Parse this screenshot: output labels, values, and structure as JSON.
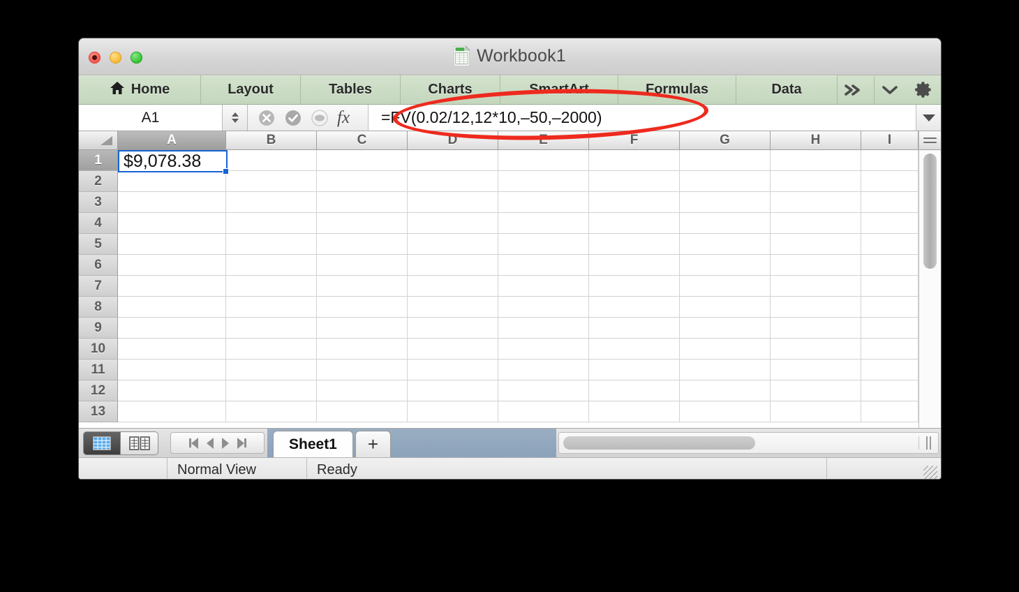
{
  "window": {
    "title": "Workbook1",
    "doc_icon": "excel-workbook-icon",
    "traffic_lights": [
      "close-button",
      "minimize-button",
      "zoom-button"
    ]
  },
  "ribbon": {
    "tabs": [
      {
        "label": "Home",
        "icon": "home-icon",
        "active": false
      },
      {
        "label": "Layout",
        "active": false
      },
      {
        "label": "Tables",
        "active": false
      },
      {
        "label": "Charts",
        "active": false
      },
      {
        "label": "SmartArt",
        "active": false
      },
      {
        "label": "Formulas",
        "active": false
      },
      {
        "label": "Data",
        "active": false
      }
    ],
    "controls": [
      {
        "name": "expand-chevrons-icon",
        "glyph": "»"
      },
      {
        "name": "collapse-ribbon-chevron-icon",
        "glyph": "⌄"
      },
      {
        "name": "settings-gear-icon",
        "glyph": "⚙"
      },
      {
        "name": "settings-dropdown-arrow-icon",
        "glyph": "▼"
      }
    ]
  },
  "formula_bar": {
    "name_box_value": "A1",
    "cancel_icon": "cancel-x-icon",
    "confirm_icon": "confirm-check-icon",
    "calculator_icon": "calculator-icon",
    "fx_label": "fx",
    "formula": "=FV(0.02/12,12*10,‒50,‒2000)",
    "expand_icon": "expand-formula-bar-icon"
  },
  "grid": {
    "columns": [
      "A",
      "B",
      "C",
      "D",
      "E",
      "F",
      "G",
      "H",
      "I"
    ],
    "rows": [
      "1",
      "2",
      "3",
      "4",
      "5",
      "6",
      "7",
      "8",
      "9",
      "10",
      "11",
      "12",
      "13"
    ],
    "selected_cell": "A1",
    "selected_column": "A",
    "selected_row": "1",
    "cells": {
      "A1": "$9,078.38"
    },
    "selection_color": "#1763d4"
  },
  "bottom": {
    "view_buttons": [
      {
        "name": "normal-view-toggle",
        "icon": "grid-view-icon",
        "active": true
      },
      {
        "name": "page-layout-view-toggle",
        "icon": "page-layout-icon",
        "active": false
      }
    ],
    "sheet_nav": [
      "first-sheet-button",
      "previous-sheet-button",
      "next-sheet-button",
      "last-sheet-button"
    ],
    "sheet_tabs": [
      {
        "label": "Sheet1",
        "active": true
      },
      {
        "label": "+",
        "active": false
      }
    ],
    "status_view": "Normal View",
    "status_state": "Ready"
  },
  "annotation": {
    "shape": "ellipse",
    "color": "#ee2a1e",
    "target": "formula-bar-formula"
  }
}
